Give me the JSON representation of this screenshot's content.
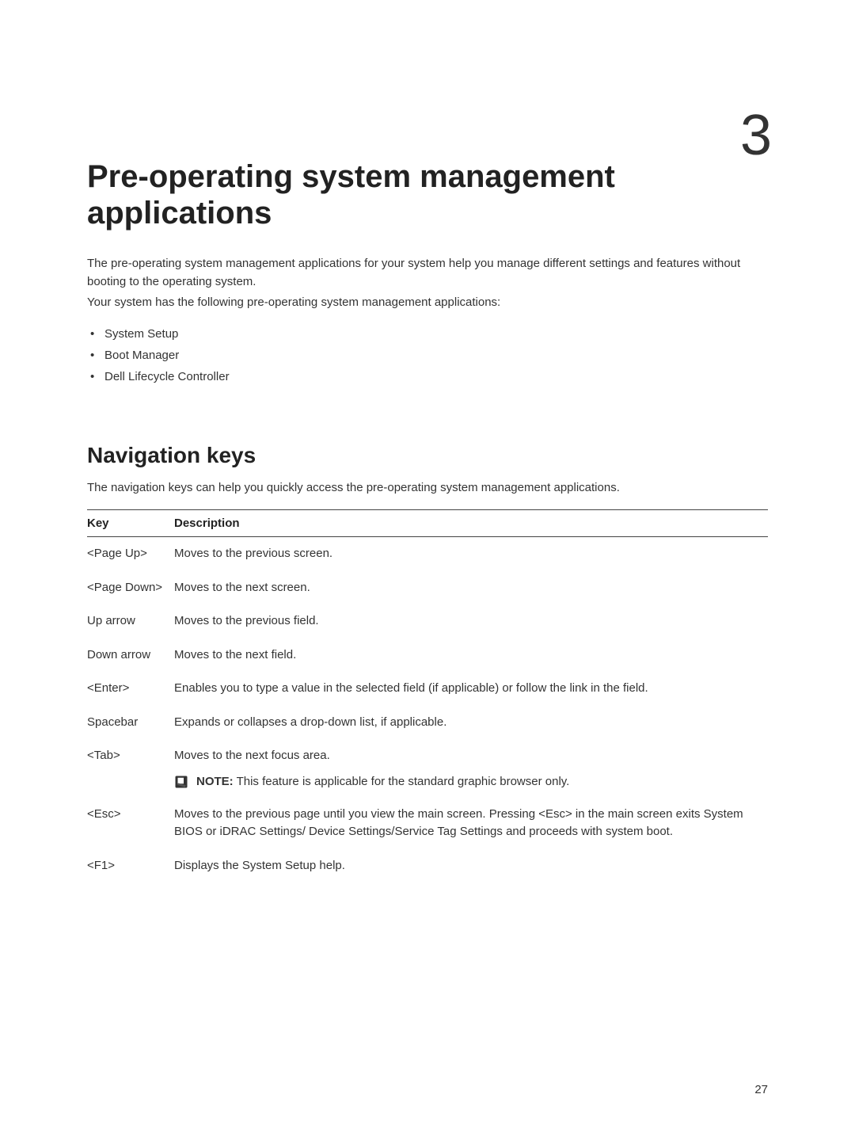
{
  "chapter": {
    "number": "3",
    "title": "Pre-operating system management applications"
  },
  "intro": {
    "para1": "The pre-operating system management applications for your system help you manage different settings and features without booting to the operating system.",
    "para2": "Your system has the following pre-operating system management applications:",
    "bullets": [
      "System Setup",
      "Boot Manager",
      "Dell Lifecycle Controller"
    ]
  },
  "section": {
    "heading": "Navigation keys",
    "intro": "The navigation keys can help you quickly access the pre-operating system management applications."
  },
  "table": {
    "headers": {
      "key": "Key",
      "description": "Description"
    },
    "rows": [
      {
        "key": "<Page Up>",
        "description": "Moves to the previous screen."
      },
      {
        "key": "<Page Down>",
        "description": "Moves to the next screen."
      },
      {
        "key": "Up arrow",
        "description": "Moves to the previous field."
      },
      {
        "key": "Down arrow",
        "description": "Moves to the next field."
      },
      {
        "key": "<Enter>",
        "description": "Enables you to type a value in the selected field (if applicable) or follow the link in the field."
      },
      {
        "key": "Spacebar",
        "description": "Expands or collapses a drop-down list, if applicable."
      },
      {
        "key": "<Tab>",
        "description": "Moves to the next focus area.",
        "note": {
          "label": "NOTE:",
          "text": " This feature is applicable for the standard graphic browser only."
        }
      },
      {
        "key": "<Esc>",
        "description": "Moves to the previous page until you view the main screen. Pressing <Esc> in the main screen exits System BIOS or iDRAC Settings/ Device Settings/Service Tag Settings and proceeds with system boot."
      },
      {
        "key": "<F1>",
        "description": "Displays the System Setup help."
      }
    ]
  },
  "page_number": "27"
}
